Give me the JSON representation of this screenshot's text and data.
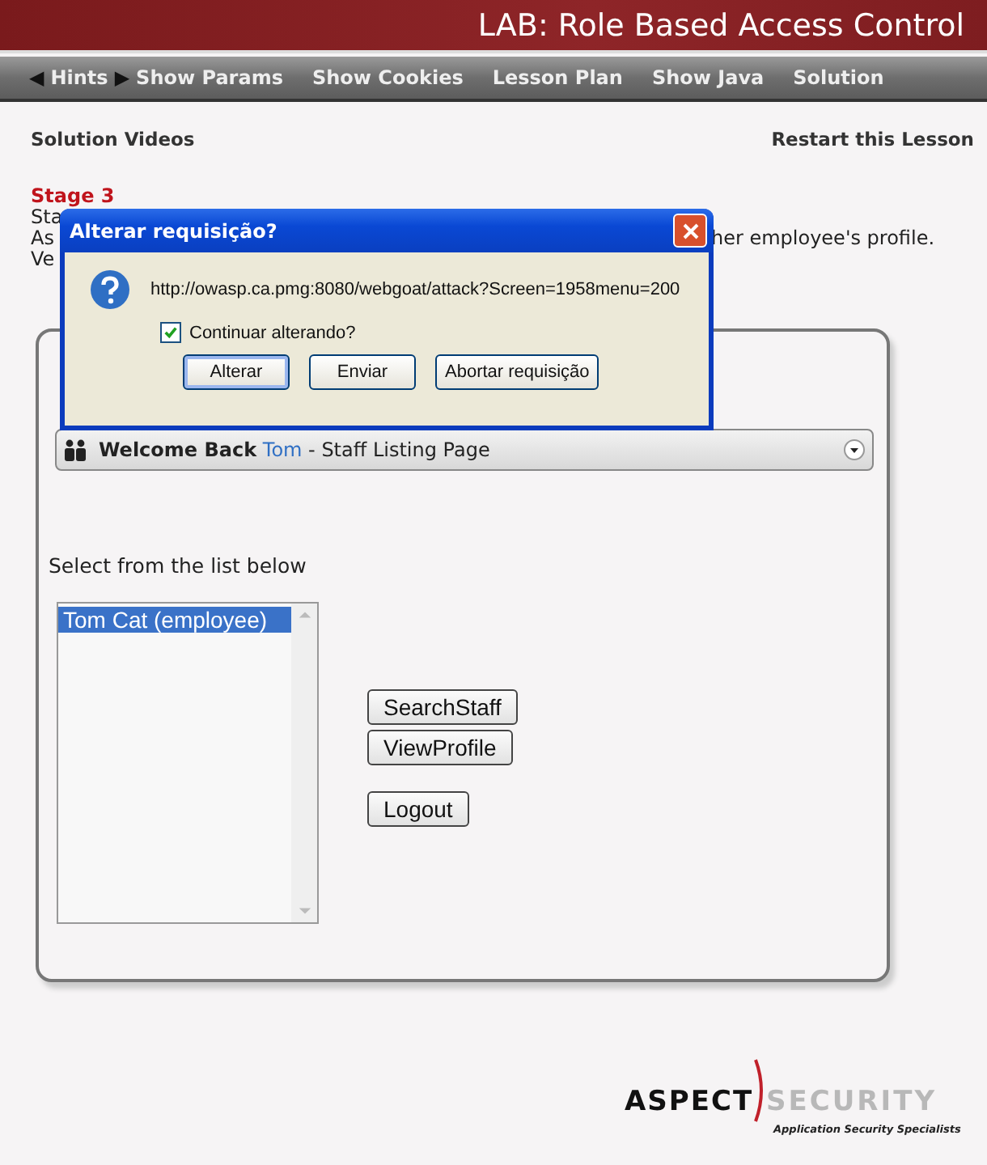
{
  "header": {
    "title": "LAB: Role Based Access Control"
  },
  "nav": {
    "prev_icon": "◀",
    "next_icon": "▶",
    "items": [
      {
        "label": "Hints"
      },
      {
        "label": "Show Params"
      },
      {
        "label": "Show Cookies"
      },
      {
        "label": "Lesson Plan"
      },
      {
        "label": "Show Java"
      },
      {
        "label": "Solution"
      }
    ]
  },
  "links": {
    "left": "Solution Videos",
    "right": "Restart this Lesson"
  },
  "lesson": {
    "stage": "Stage 3",
    "lines": [
      {
        "left": "Sta"
      },
      {
        "left": "As",
        "right": "her employee's profile."
      },
      {
        "left": "Ve"
      }
    ]
  },
  "panel": {
    "welcome": "Welcome Back",
    "user": "Tom",
    "page": "- Staff Listing Page",
    "prompt": "Select from the list below",
    "staff": [
      {
        "name": "Tom Cat (employee)",
        "selected": true
      }
    ],
    "buttons": [
      "SearchStaff",
      "ViewProfile",
      "Logout"
    ]
  },
  "dialog": {
    "title": "Alterar requisição?",
    "url": "http://owasp.ca.pmg:8080/webgoat/attack?Screen=1958menu=200",
    "checkbox": {
      "label": "Continuar alterando?",
      "checked": true
    },
    "buttons": [
      {
        "label": "Alterar",
        "default": true
      },
      {
        "label": "Enviar",
        "default": false
      },
      {
        "label": "Abortar requisição",
        "default": false
      }
    ]
  },
  "logo": {
    "left": "ASPECT",
    "right": "SECURITY",
    "tagline": "Application Security Specialists"
  }
}
